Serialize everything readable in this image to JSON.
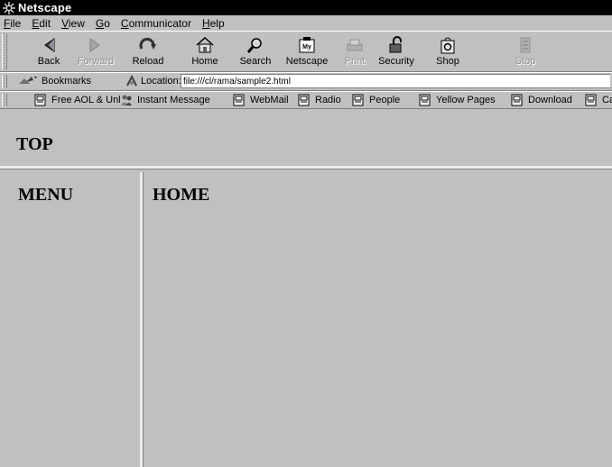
{
  "window": {
    "title": "Netscape"
  },
  "menubar": {
    "items": [
      {
        "label": "File",
        "accel": "F",
        "rest": "ile"
      },
      {
        "label": "Edit",
        "accel": "E",
        "rest": "dit"
      },
      {
        "label": "View",
        "accel": "V",
        "rest": "iew"
      },
      {
        "label": "Go",
        "accel": "G",
        "rest": "o"
      },
      {
        "label": "Communicator",
        "accel": "C",
        "rest": "ommunicator"
      },
      {
        "label": "Help",
        "accel": "H",
        "rest": "elp"
      }
    ]
  },
  "navbar": {
    "back": "Back",
    "forward": "Forward",
    "reload": "Reload",
    "home": "Home",
    "search": "Search",
    "netscape": "Netscape",
    "print": "Print",
    "security": "Security",
    "shop": "Shop",
    "stop": "Stop"
  },
  "location": {
    "bookmarks_label": "Bookmarks",
    "location_label": "Location:",
    "url": "file:///cl/rama/sample2.html"
  },
  "personal_toolbar": {
    "items": [
      "Free AOL & Unl",
      "Instant Message",
      "WebMail",
      "Radio",
      "People",
      "Yellow Pages",
      "Download",
      "Ca"
    ]
  },
  "page": {
    "top_heading": "TOP",
    "menu_heading": "MENU",
    "home_heading": "HOME"
  }
}
